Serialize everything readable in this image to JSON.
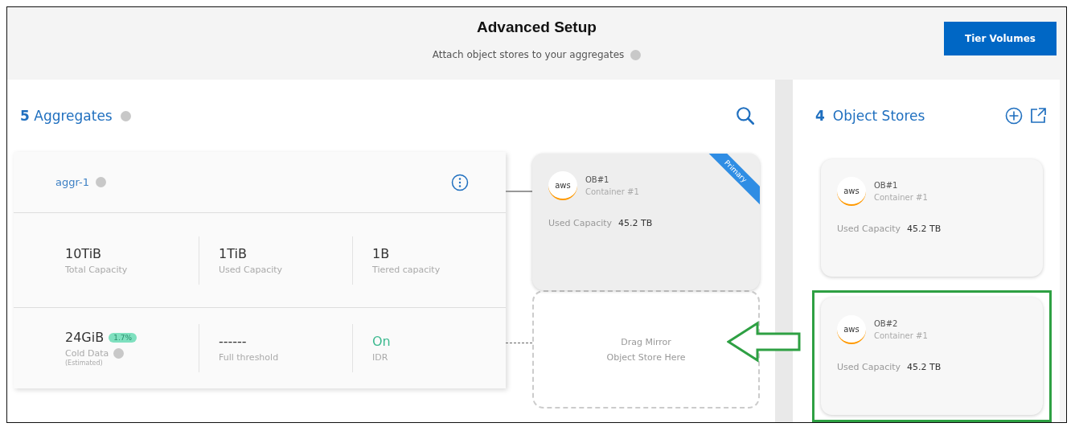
{
  "header": {
    "title": "Advanced Setup",
    "subtitle": "Attach object stores to your aggregates",
    "button": "Tier Volumes"
  },
  "aggregates": {
    "count": "5",
    "label": "Aggregates",
    "card": {
      "name": "aggr-1",
      "metrics": [
        {
          "value": "10TiB",
          "label": "Total Capacity"
        },
        {
          "value": "1TiB",
          "label": "Used Capacity"
        },
        {
          "value": "1B",
          "label": "Tiered capacity"
        }
      ],
      "details": [
        {
          "kind": "cold",
          "value": "24GiB",
          "badge": "1.7%",
          "label": "Cold Data",
          "note": "(Estimated)"
        },
        {
          "kind": "plain",
          "value": "------",
          "label": "Full threshold"
        },
        {
          "kind": "status",
          "value": "On",
          "label": "IDR"
        }
      ]
    },
    "attached": {
      "logo": "aws",
      "name": "OB#1",
      "container": "Container #1",
      "ribbon": "Primary",
      "capacity_label": "Used Capacity",
      "capacity": "45.2 TB"
    },
    "drop_zone": {
      "lines": [
        "Drag Mirror",
        "Object Store Here"
      ]
    }
  },
  "object_stores": {
    "count": "4",
    "label": "Object Stores",
    "items": [
      {
        "logo": "aws",
        "name": "OB#1",
        "container": "Container #1",
        "capacity_label": "Used Capacity",
        "capacity": "45.2 TB",
        "highlighted": false
      },
      {
        "logo": "aws",
        "name": "OB#2",
        "container": "Container #1",
        "capacity_label": "Used Capacity",
        "capacity": "45.2 TB",
        "highlighted": true
      }
    ]
  }
}
